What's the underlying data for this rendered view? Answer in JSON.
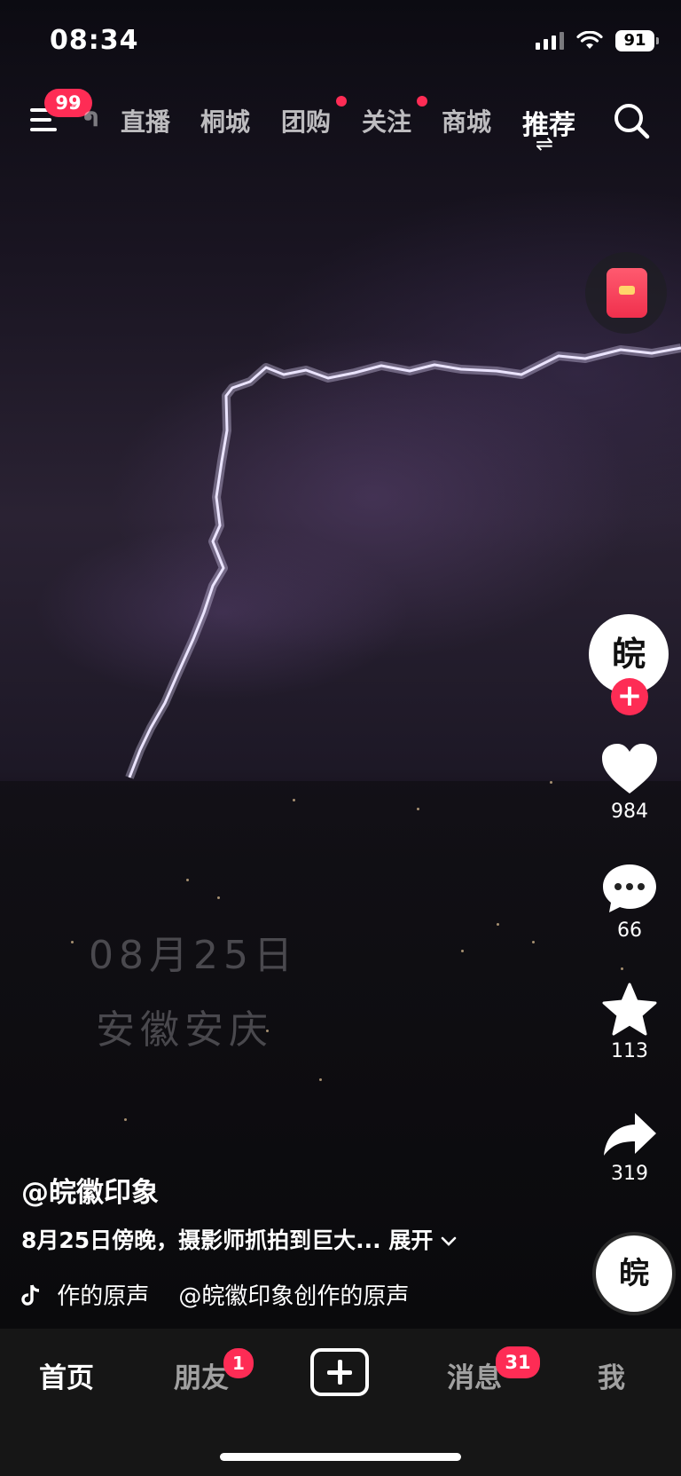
{
  "status_bar": {
    "time": "08:34",
    "battery": "91"
  },
  "top_nav": {
    "menu_badge": "99",
    "tabs": [
      {
        "label": "直播",
        "dot": false
      },
      {
        "label": "桐城",
        "dot": false
      },
      {
        "label": "团购",
        "dot": true
      },
      {
        "label": "关注",
        "dot": true
      },
      {
        "label": "商城",
        "dot": false
      },
      {
        "label": "推荐",
        "active": true
      }
    ],
    "clipped_tab_glyph": "ຳ",
    "swap_glyph": "⇌"
  },
  "video_overlay": {
    "date": "08月25日",
    "place": "安徽安庆"
  },
  "side_actions": {
    "avatar_text": "皖",
    "likes": "984",
    "comments": "66",
    "favorites": "113",
    "shares": "319",
    "disc_text": "皖"
  },
  "post": {
    "author": "@皖徽印象",
    "description": "8月25日傍晚，摄影师抓拍到巨大...",
    "expand_label": "展开",
    "music": "作的原声    @皖徽印象创作的原声"
  },
  "bottom_tabs": {
    "home": "首页",
    "friends": "朋友",
    "friends_badge": "1",
    "messages": "消息",
    "messages_badge": "31",
    "me": "我"
  },
  "colors": {
    "accent": "#fe2c55",
    "background": "#000000",
    "tabbar": "#161616"
  },
  "icons": [
    "menu-icon",
    "search-icon",
    "red-packet-icon",
    "heart-icon",
    "comment-icon",
    "star-icon",
    "share-icon",
    "music-note-icon",
    "chevron-down-icon",
    "plus-icon"
  ]
}
